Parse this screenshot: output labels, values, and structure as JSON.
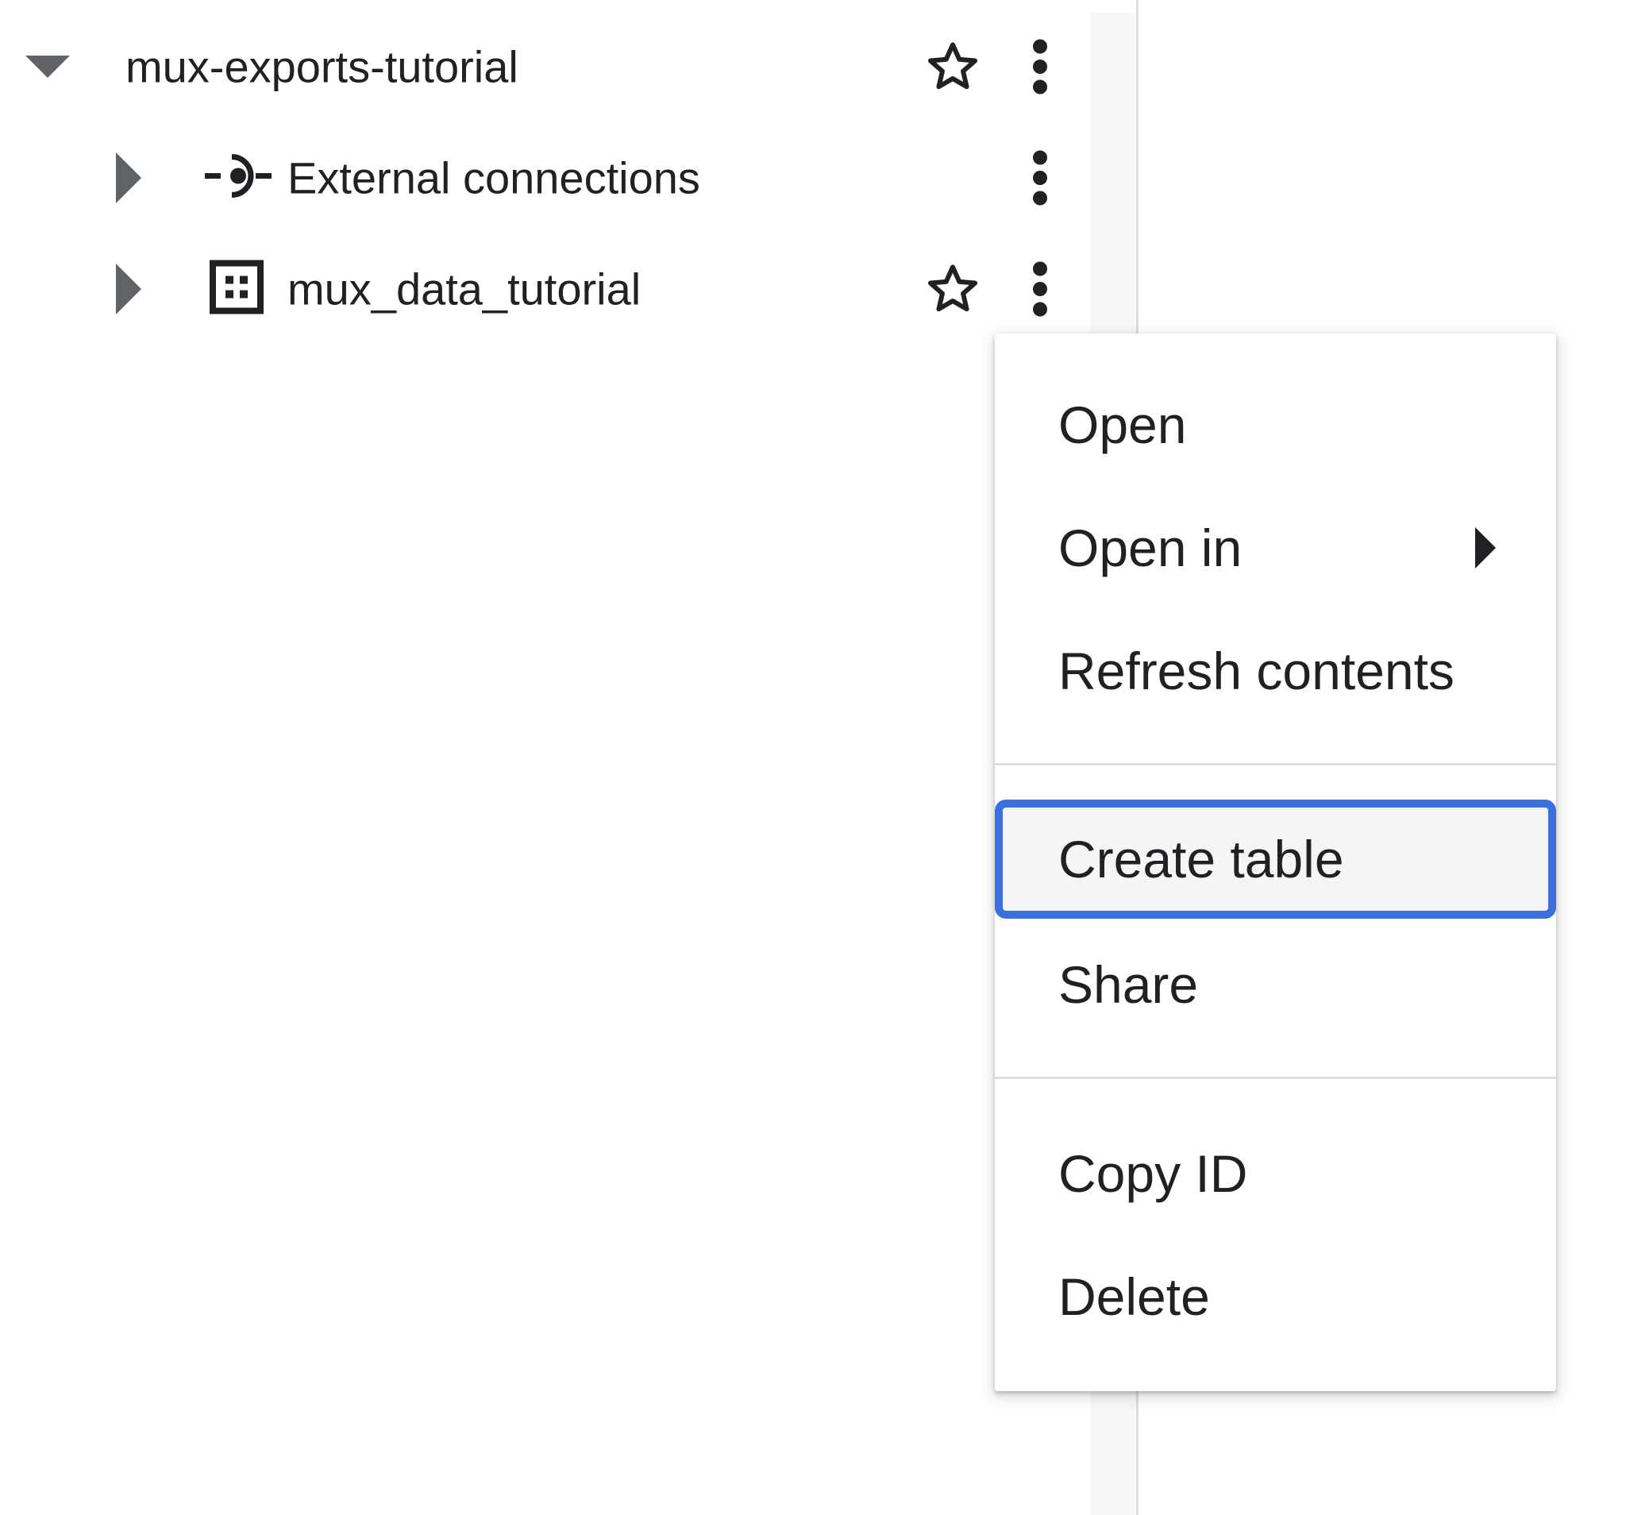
{
  "explorer": {
    "project": {
      "name": "mux-exports-tutorial",
      "icons": {
        "expander": "caret-down-icon",
        "star": "star-outline-icon",
        "more": "more-vert-icon"
      }
    },
    "children": [
      {
        "name": "External connections",
        "icon": "external-connection-icon",
        "expander": "caret-right-icon",
        "starred_visible": false
      },
      {
        "name": "mux_data_tutorial",
        "icon": "dataset-icon",
        "expander": "caret-right-icon",
        "starred_visible": true
      }
    ]
  },
  "context_menu": {
    "items": [
      {
        "label": "Open"
      },
      {
        "label": "Open in",
        "has_submenu": true
      },
      {
        "label": "Refresh contents"
      },
      {
        "label": "Create table",
        "focused": true
      },
      {
        "label": "Share"
      },
      {
        "label": "Copy ID"
      },
      {
        "label": "Delete"
      }
    ]
  },
  "colors": {
    "focus_ring": "#3b6fdc",
    "text": "#202124",
    "icon_grey": "#5f6368",
    "focused_bg": "#f5f5f5"
  }
}
